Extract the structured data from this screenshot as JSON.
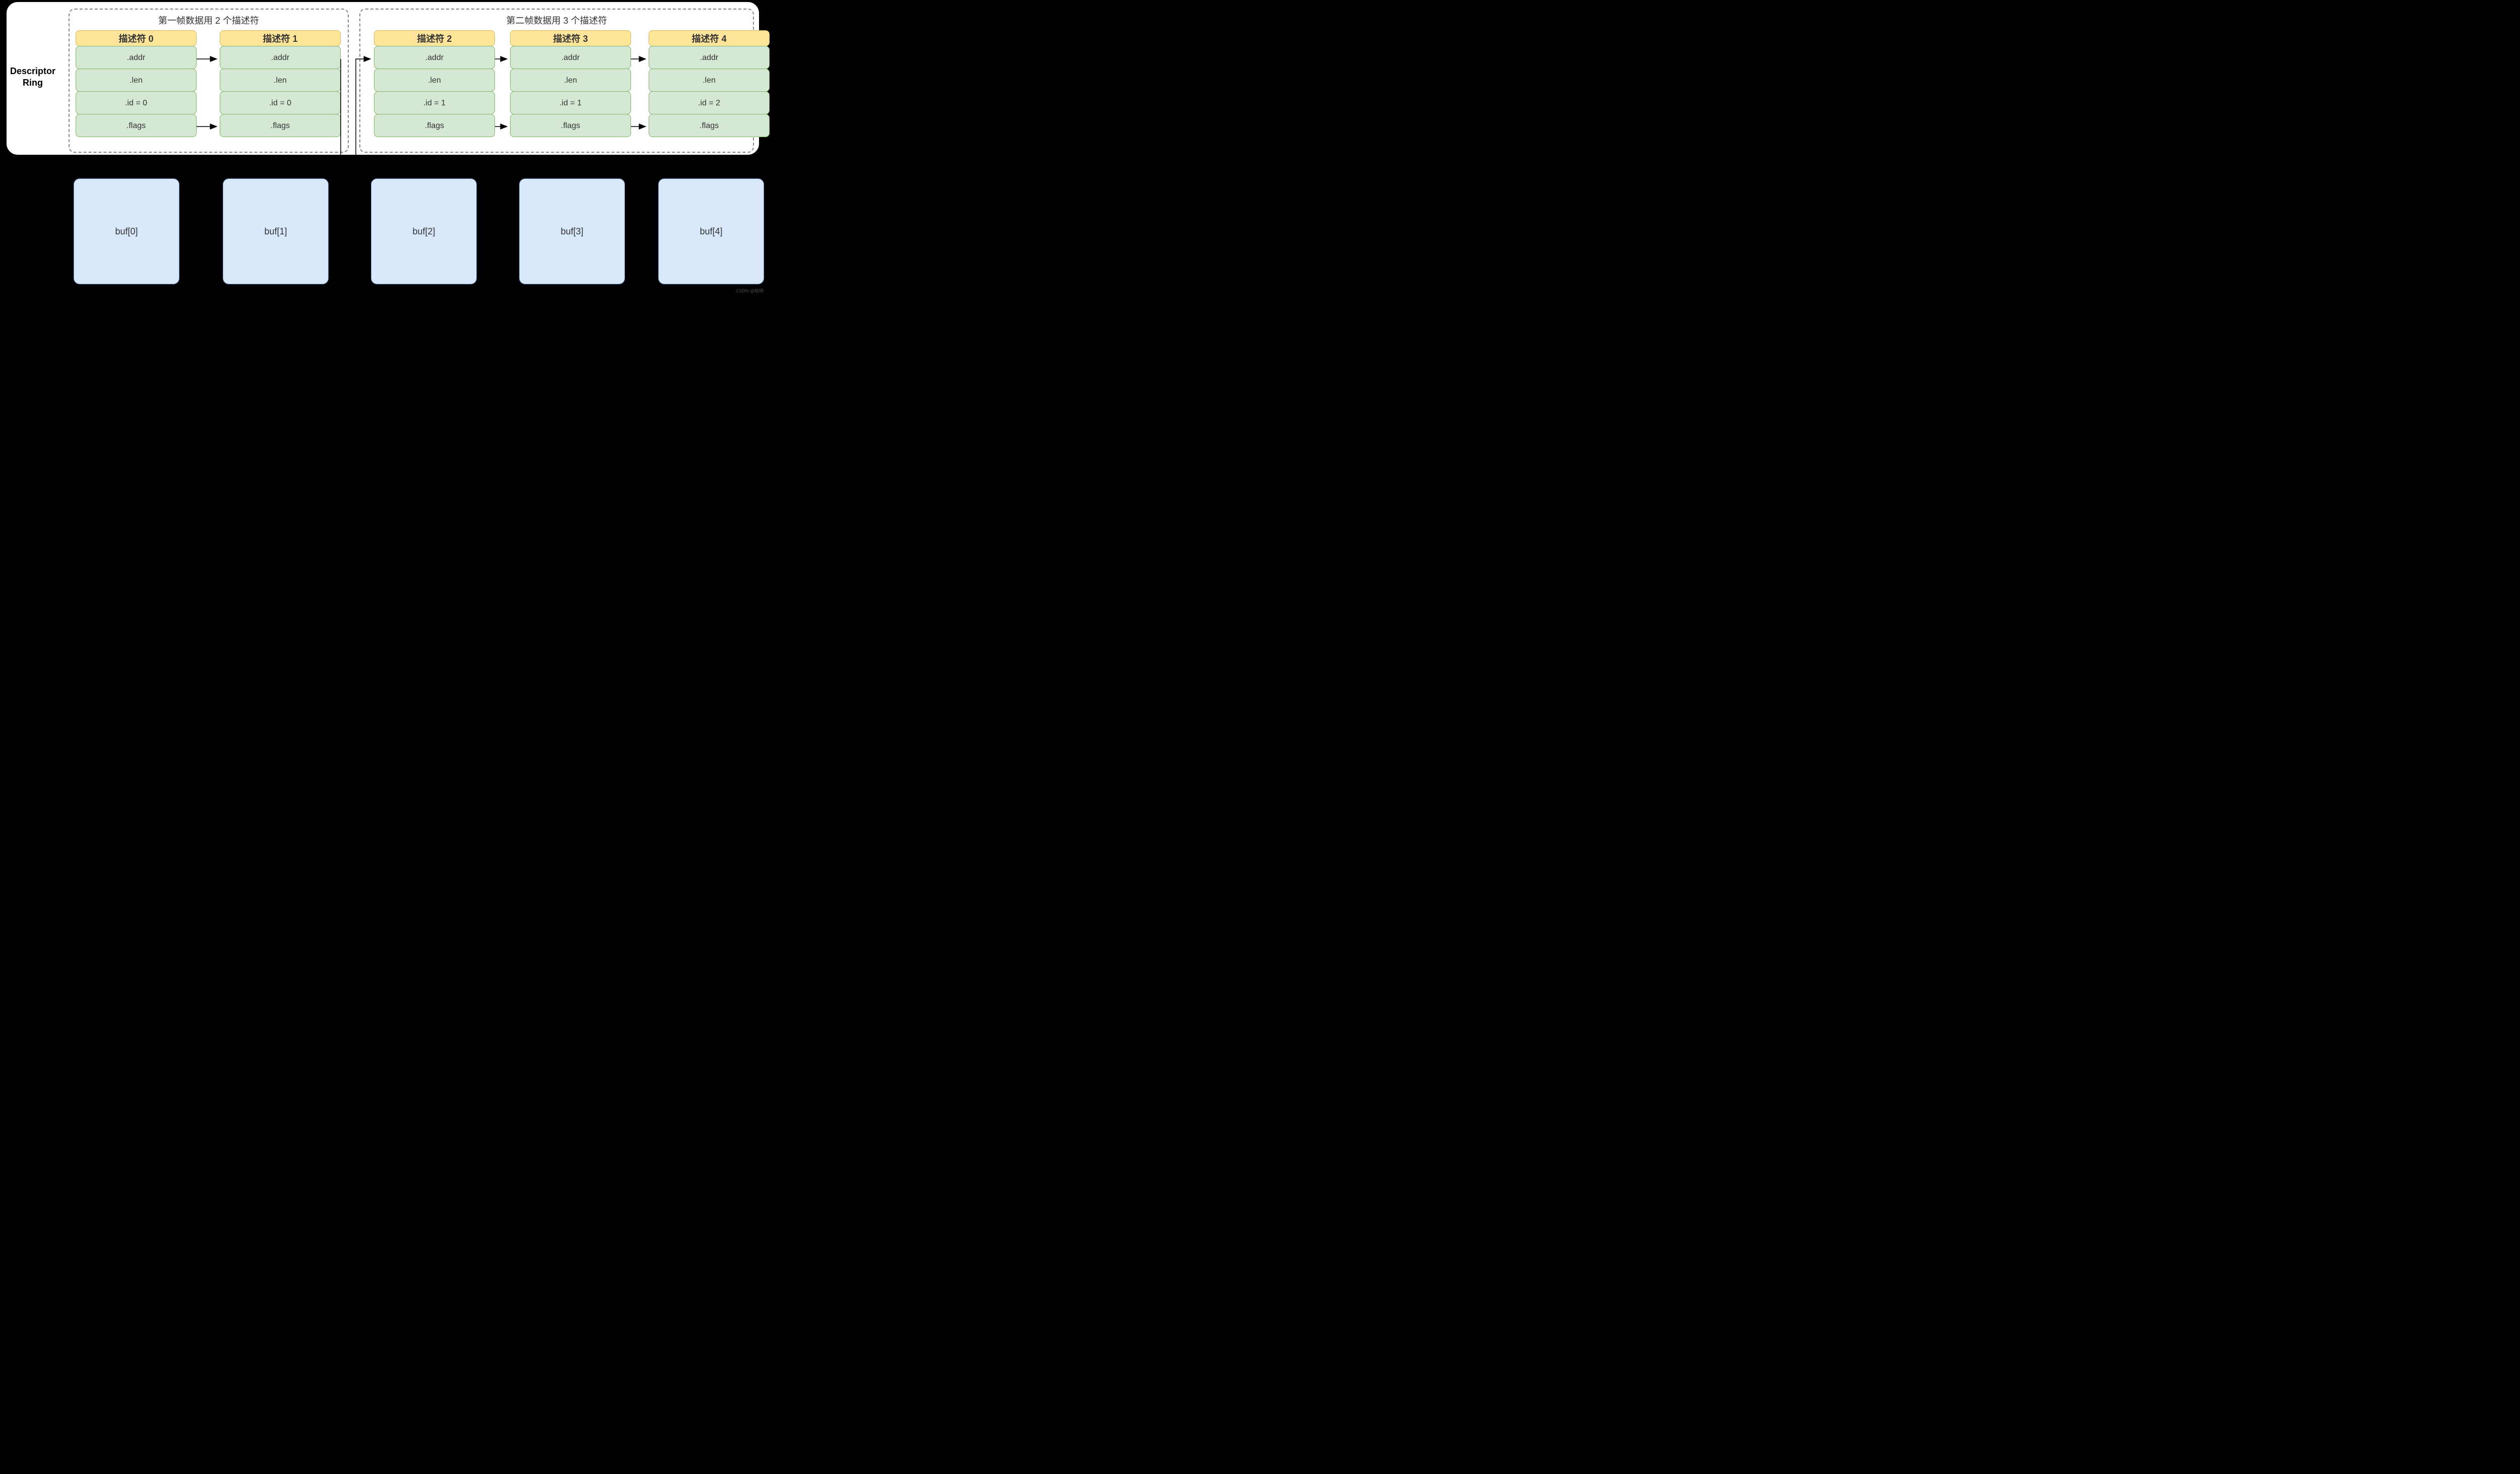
{
  "ring_label_1": "Descriptor",
  "ring_label_2": "Ring",
  "frames": [
    {
      "label": "第一帧数据用 2 个描述符"
    },
    {
      "label": "第二帧数据用 3 个描述符"
    }
  ],
  "descriptors": [
    {
      "title": "描述符 0",
      "addr": ".addr",
      "len": ".len",
      "id": ".id = 0",
      "flags": ".flags"
    },
    {
      "title": "描述符 1",
      "addr": ".addr",
      "len": ".len",
      "id": ".id = 0",
      "flags": ".flags"
    },
    {
      "title": "描述符 2",
      "addr": ".addr",
      "len": ".len",
      "id": ".id = 1",
      "flags": ".flags"
    },
    {
      "title": "描述符 3",
      "addr": ".addr",
      "len": ".len",
      "id": ".id = 1",
      "flags": ".flags"
    },
    {
      "title": "描述符 4",
      "addr": ".addr",
      "len": ".len",
      "id": ".id = 2",
      "flags": ".flags"
    }
  ],
  "buffers": [
    {
      "label": "buf[0]"
    },
    {
      "label": "buf[1]"
    },
    {
      "label": "buf[2]"
    },
    {
      "label": "buf[3]"
    },
    {
      "label": "buf[4]"
    }
  ],
  "watermark": "CSDN @柏晓"
}
